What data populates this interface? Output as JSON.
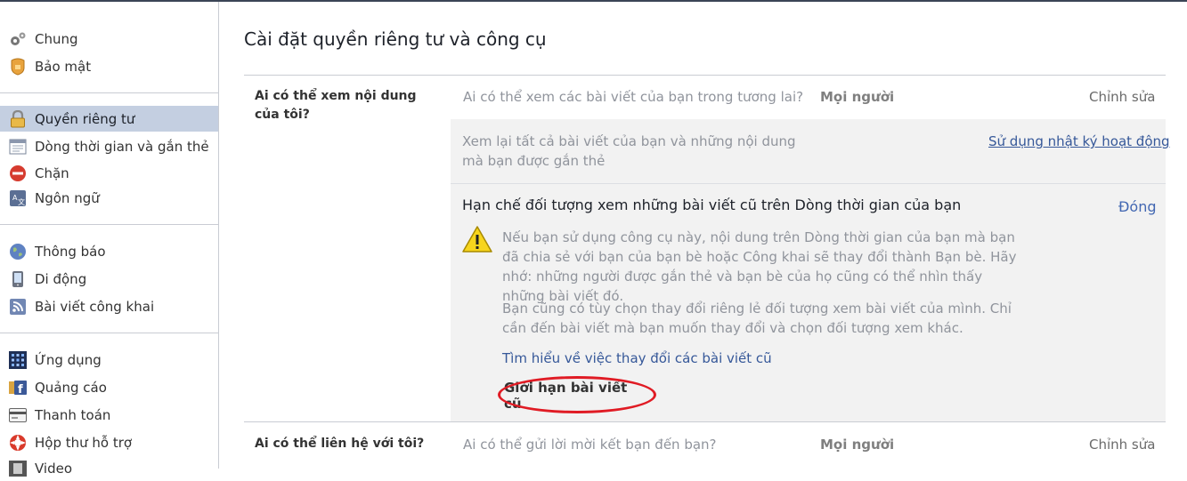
{
  "sidebar": {
    "items": [
      {
        "label": "Chung",
        "icon": "gears-icon"
      },
      {
        "label": "Bảo mật",
        "icon": "shield-badge-icon"
      },
      {
        "label": "Quyền riêng tư",
        "icon": "padlock-icon",
        "active": true
      },
      {
        "label": "Dòng thời gian và gắn thẻ",
        "icon": "timeline-icon"
      },
      {
        "label": "Chặn",
        "icon": "block-icon"
      },
      {
        "label": "Ngôn ngữ",
        "icon": "language-icon"
      },
      {
        "label": "Thông báo",
        "icon": "globe-icon"
      },
      {
        "label": "Di động",
        "icon": "mobile-icon"
      },
      {
        "label": "Bài viết công khai",
        "icon": "rss-icon"
      },
      {
        "label": "Ứng dụng",
        "icon": "apps-icon"
      },
      {
        "label": "Quảng cáo",
        "icon": "facebook-ads-icon"
      },
      {
        "label": "Thanh toán",
        "icon": "credit-card-icon"
      },
      {
        "label": "Hộp thư hỗ trợ",
        "icon": "lifebuoy-icon"
      },
      {
        "label": "Video",
        "icon": "film-icon"
      }
    ]
  },
  "main": {
    "title": "Cài đặt quyền riêng tư và công cụ",
    "section1": {
      "label": "Ai có thể xem nội dung của tôi?",
      "question": "Ai có thể xem các bài viết của bạn trong tương lai?",
      "value": "Mọi người",
      "edit": "Chỉnh sửa",
      "review_text": "Xem lại tất cả bài viết của bạn và những nội dung mà bạn được gắn thẻ",
      "activity_log_link": "Sử dụng nhật ký hoạt động",
      "limit": {
        "title": "Hạn chế đối tượng xem những bài viết cũ trên Dòng thời gian của bạn",
        "close": "Đóng",
        "warning": "Nếu bạn sử dụng công cụ này, nội dung trên Dòng thời gian của bạn mà bạn đã chia sẻ với bạn của bạn bè hoặc Công khai sẽ thay đổi thành Bạn bè. Hãy nhớ: những người được gắn thẻ và bạn bè của họ cũng có thể nhìn thấy những bài viết đó.",
        "note": "Bạn cũng có tùy chọn thay đổi riêng lẻ đối tượng xem bài viết của mình. Chỉ cần đến bài viết mà bạn muốn thay đổi và chọn đối tượng xem khác.",
        "learn_more": "Tìm hiểu về việc thay đổi các bài viết cũ",
        "button": "Giới hạn bài viết cũ"
      }
    },
    "section2": {
      "label": "Ai có thể liên hệ với tôi?",
      "question": "Ai có thể gửi lời mời kết bạn đến bạn?",
      "value": "Mọi người",
      "edit": "Chỉnh sửa"
    }
  },
  "colors": {
    "active_bg": "#c4cfe1",
    "link": "#365899",
    "highlight_oval": "#e01b24",
    "panel_bg": "#f2f2f2"
  }
}
